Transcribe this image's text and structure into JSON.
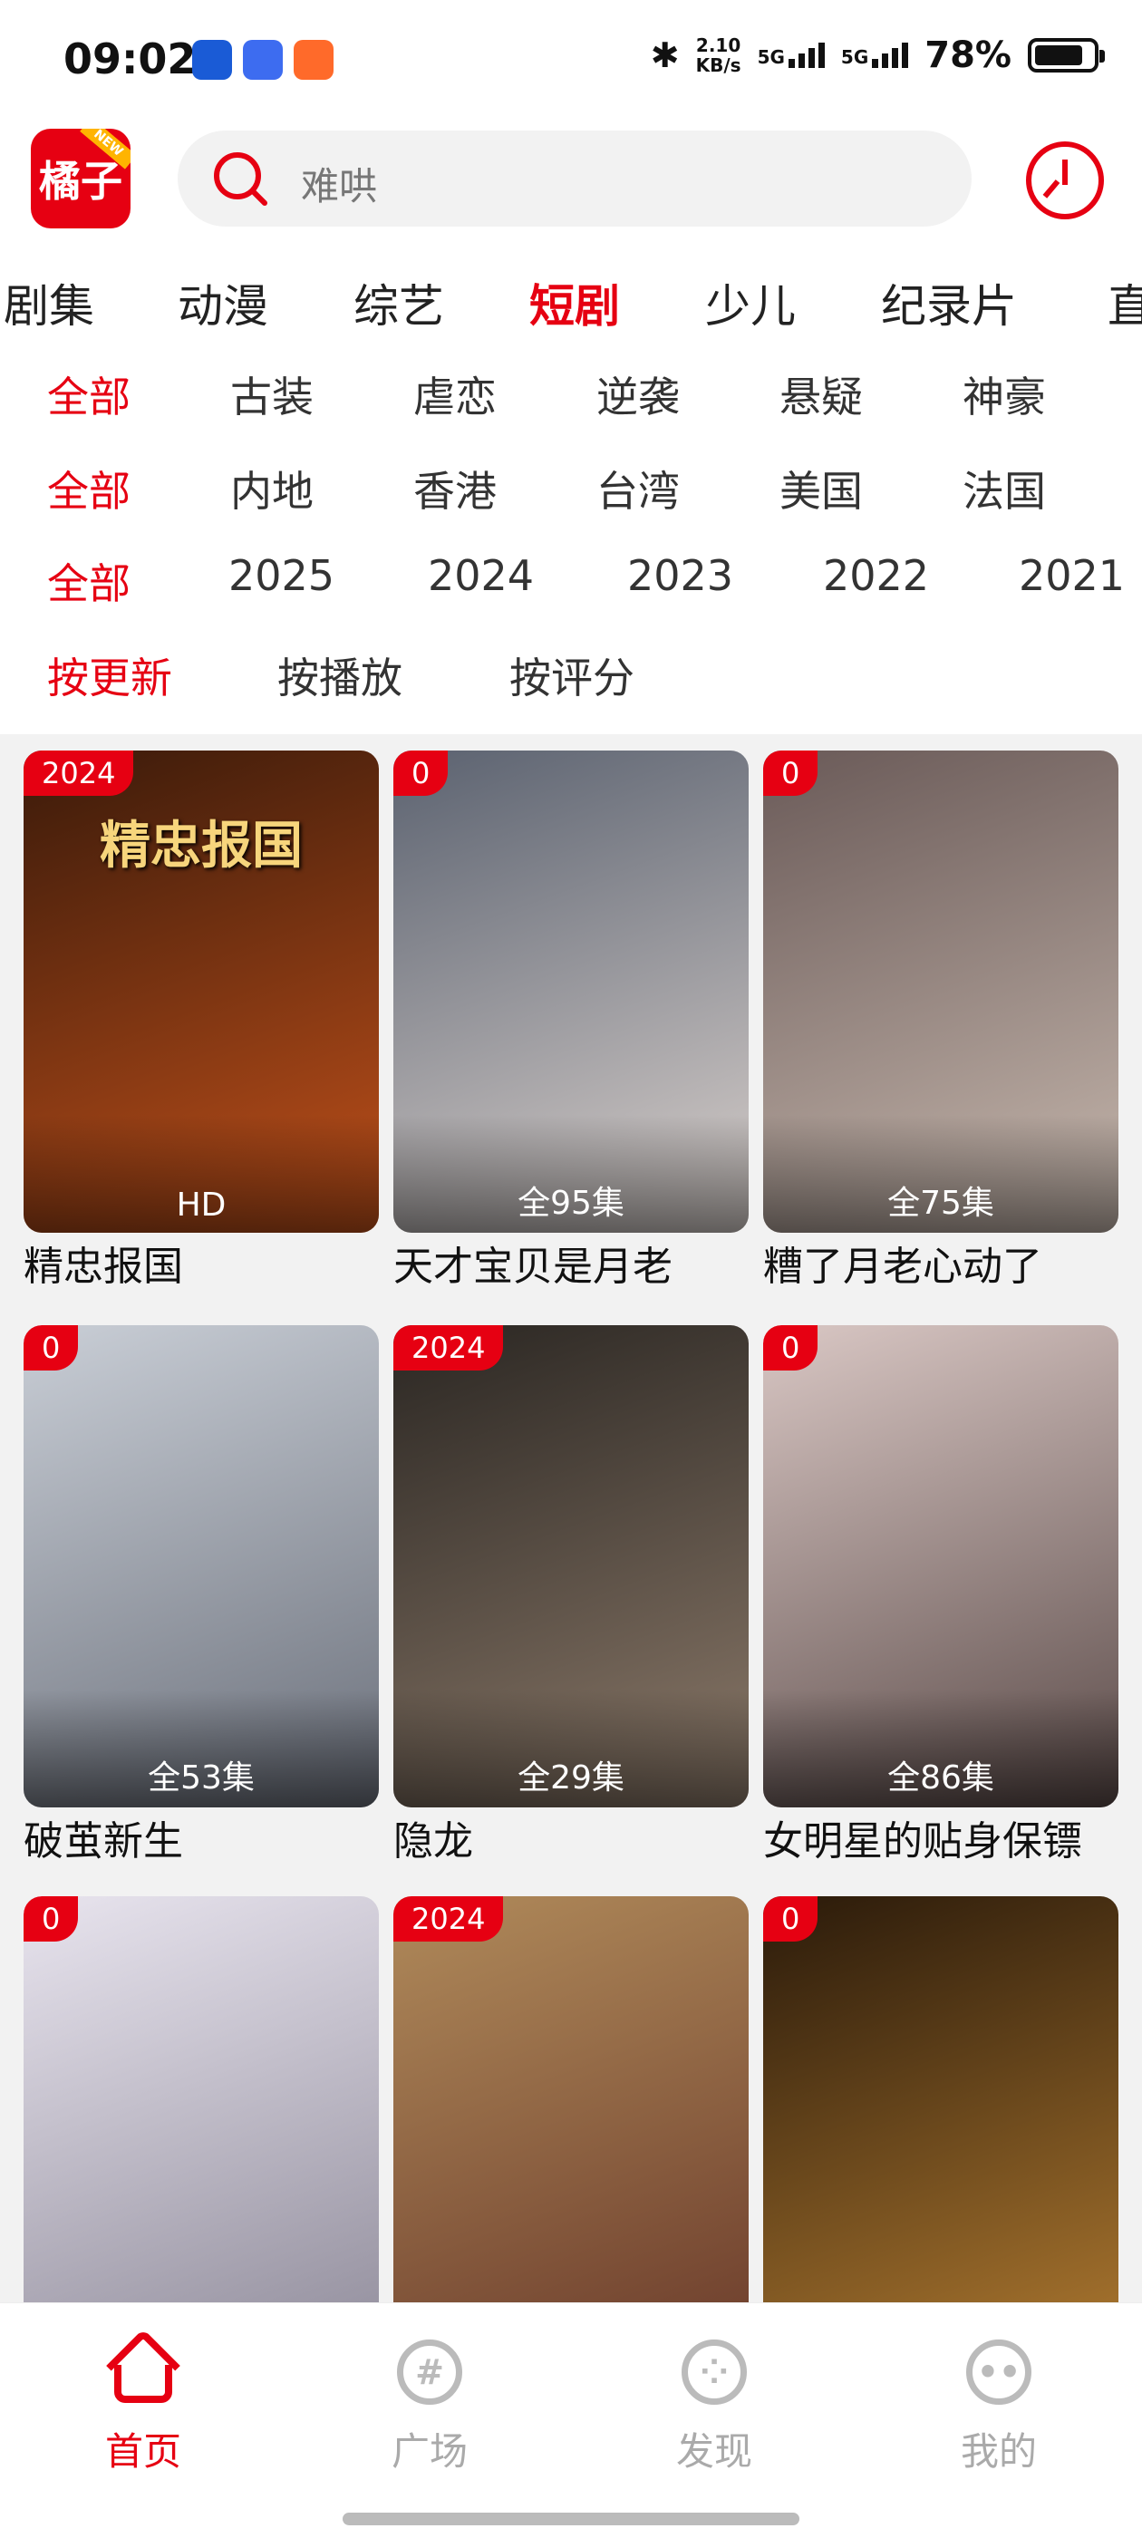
{
  "status": {
    "time": "09:02",
    "speed": "2.10",
    "speed_unit": "KB/s",
    "sig1": "5G",
    "sig2": "5G",
    "battery": "78%"
  },
  "header": {
    "logo": "橘子",
    "logo_badge": "NEW",
    "search_placeholder": "难哄"
  },
  "tabs": [
    "剧集",
    "动漫",
    "综艺",
    "短剧",
    "少儿",
    "纪录片",
    "直"
  ],
  "active_tab": "短剧",
  "filters": {
    "genre": [
      "全部",
      "古装",
      "虐恋",
      "逆袭",
      "悬疑",
      "神豪"
    ],
    "region": [
      "全部",
      "内地",
      "香港",
      "台湾",
      "美国",
      "法国"
    ],
    "year": [
      "全部",
      "2025",
      "2024",
      "2023",
      "2022",
      "2021"
    ],
    "sort": [
      "按更新",
      "按播放",
      "按评分"
    ]
  },
  "cards": [
    {
      "badge": "2024",
      "poster_text": "精忠报国",
      "episodes": "HD",
      "title": "精忠报国",
      "color1": "#3a1a0a",
      "color2": "#c0501a"
    },
    {
      "badge": "0",
      "poster_text": "",
      "episodes": "全95集",
      "title": "天才宝贝是月老",
      "color1": "#5b6270",
      "color2": "#d8d0cc"
    },
    {
      "badge": "0",
      "poster_text": "",
      "episodes": "全75集",
      "title": "糟了月老心动了",
      "color1": "#6a5a58",
      "color2": "#c7b8ae"
    },
    {
      "badge": "0",
      "poster_text": "",
      "episodes": "全53集",
      "title": "破茧新生",
      "color1": "#c9ced6",
      "color2": "#6a6f7a"
    },
    {
      "badge": "2024",
      "poster_text": "",
      "episodes": "全29集",
      "title": "隐龙",
      "color1": "#2a2622",
      "color2": "#8c7a6a"
    },
    {
      "badge": "0",
      "poster_text": "",
      "episodes": "全86集",
      "title": "女明星的贴身保镖",
      "color1": "#d9c7c4",
      "color2": "#5a4a48"
    },
    {
      "badge": "0",
      "poster_text": "",
      "episodes": "",
      "title": "",
      "color1": "#e8e4ee",
      "color2": "#8e8a99"
    },
    {
      "badge": "2024",
      "poster_text": "",
      "episodes": "",
      "title": "",
      "color1": "#b08a5a",
      "color2": "#6a3a2a"
    },
    {
      "badge": "0",
      "poster_text": "",
      "episodes": "",
      "title": "",
      "color1": "#2a1a0a",
      "color2": "#b07a30"
    }
  ],
  "nav": [
    {
      "label": "首页",
      "icon": "home-icon",
      "active": true
    },
    {
      "label": "广场",
      "icon": "plaza-icon",
      "glyph": "#"
    },
    {
      "label": "发现",
      "icon": "discover-icon",
      "glyph": "⁘"
    },
    {
      "label": "我的",
      "icon": "profile-icon",
      "glyph": "••"
    }
  ],
  "colors": {
    "accent": "#e60012",
    "background": "#f2f2f2"
  }
}
